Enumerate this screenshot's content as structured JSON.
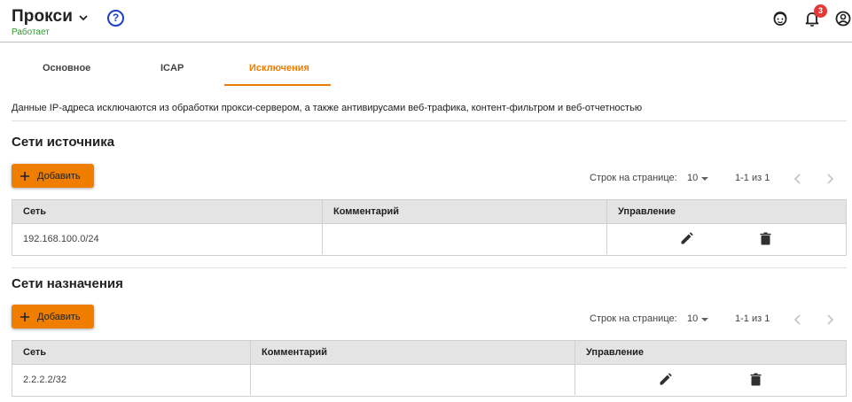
{
  "header": {
    "title": "Прокси",
    "status": "Работает",
    "help_symbol": "?",
    "notifications_count": "3"
  },
  "tabs": [
    {
      "label": "Основное",
      "active": false
    },
    {
      "label": "ICAP",
      "active": false
    },
    {
      "label": "Исключения",
      "active": true
    }
  ],
  "description": "Данные IP-адреса исключаются из обработки прокси-сервером, а также антивирусами веб-трафика, контент-фильтром и веб-отчетностью",
  "sections": [
    {
      "title": "Сети источника",
      "add_label": "Добавить",
      "pager": {
        "rows_label": "Строк на странице:",
        "rows_value": "10",
        "range": "1-1 из 1"
      },
      "columns": [
        "Сеть",
        "Комментарий",
        "Управление"
      ],
      "rows": [
        {
          "network": "192.168.100.0/24",
          "comment": ""
        }
      ]
    },
    {
      "title": "Сети назначения",
      "add_label": "Добавить",
      "pager": {
        "rows_label": "Строк на странице:",
        "rows_value": "10",
        "range": "1-1 из 1"
      },
      "columns": [
        "Сеть",
        "Комментарий",
        "Управление"
      ],
      "rows": [
        {
          "network": "2.2.2.2/32",
          "comment": ""
        }
      ]
    }
  ],
  "icons": {
    "chevron": "chevron-down-icon",
    "help": "help-circle-icon",
    "support": "support-agent-icon",
    "notifications": "bell-icon",
    "account": "account-circle-icon",
    "add": "plus-icon",
    "edit": "pencil-icon",
    "delete": "trash-icon",
    "prev": "chevron-left-icon",
    "next": "chevron-right-icon"
  },
  "colors": {
    "accent": "#ef7d00",
    "status_ok": "#2e9a2e",
    "help_blue": "#1e40c8",
    "badge_red": "#e53935",
    "table_header_bg": "#e4e4e4"
  }
}
